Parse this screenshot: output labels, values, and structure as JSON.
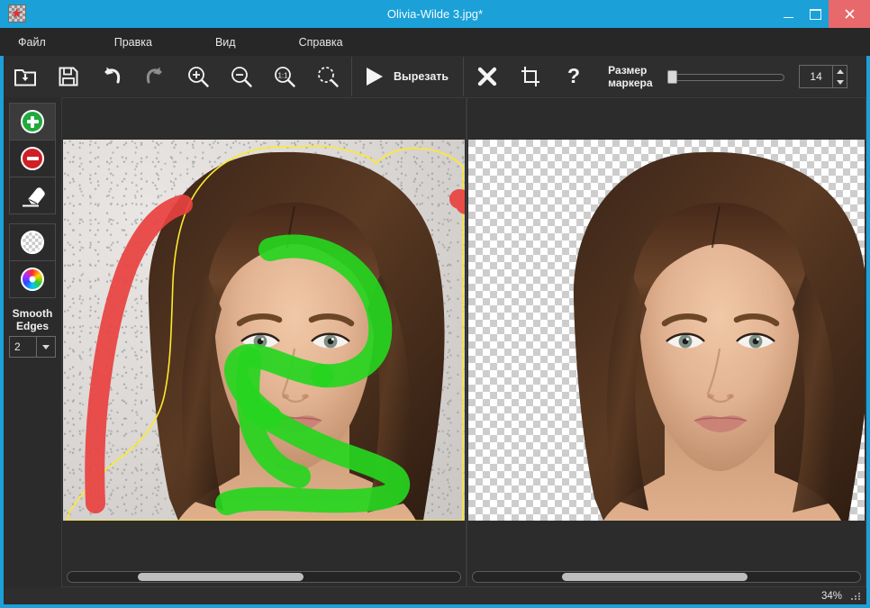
{
  "window": {
    "title": "Olivia-Wilde 3.jpg*",
    "app_icon": "app-logo-icon",
    "minimize": "–",
    "maximize": "□",
    "close": "✕",
    "accent_color": "#1ba1d8",
    "close_color": "#e8696b"
  },
  "menubar": {
    "items": [
      {
        "label": "Файл",
        "name": "menu-file"
      },
      {
        "label": "Правка",
        "name": "menu-edit"
      },
      {
        "label": "Вид",
        "name": "menu-view"
      },
      {
        "label": "Справка",
        "name": "menu-help"
      }
    ]
  },
  "toolbar": {
    "buttons": [
      {
        "name": "open-button",
        "icon": "folder-download-icon",
        "tooltip": "Открыть"
      },
      {
        "name": "save-button",
        "icon": "floppy-save-icon",
        "tooltip": "Сохранить"
      },
      {
        "name": "undo-button",
        "icon": "undo-arrow-icon",
        "tooltip": "Отменить"
      },
      {
        "name": "redo-button",
        "icon": "redo-arrow-icon",
        "tooltip": "Повторить",
        "disabled": true
      },
      {
        "name": "zoom-in-button",
        "icon": "magnifier-plus-icon",
        "tooltip": "Увеличить"
      },
      {
        "name": "zoom-out-button",
        "icon": "magnifier-minus-icon",
        "tooltip": "Уменьшить"
      },
      {
        "name": "zoom-actual-button",
        "icon": "magnifier-1-1-icon",
        "tooltip": "1:1"
      },
      {
        "name": "zoom-fit-button",
        "icon": "magnifier-fit-icon",
        "tooltip": "По размеру окна"
      }
    ],
    "cut_button": {
      "label": "Вырезать",
      "icon": "play-triangle-icon",
      "name": "cut-button"
    },
    "clear_button": {
      "name": "clear-marks-button",
      "icon": "cross-x-icon"
    },
    "crop_button": {
      "name": "crop-button",
      "icon": "crop-icon"
    },
    "help_button": {
      "name": "help-button",
      "icon": "question-mark-icon"
    },
    "marker_size": {
      "label_line1": "Размер",
      "label_line2": "маркера",
      "value": "14",
      "slider_percent": 3,
      "spin_up": "▲",
      "spin_down": "▼"
    }
  },
  "tools": {
    "foreground": {
      "name": "marker-foreground-tool",
      "icon": "green-plus-circle-icon",
      "active": true
    },
    "background": {
      "name": "marker-background-tool",
      "icon": "red-minus-circle-icon",
      "active": false
    },
    "eraser": {
      "name": "eraser-tool",
      "icon": "eraser-icon",
      "active": false
    },
    "transparent_bg": {
      "name": "transparent-background-tool",
      "icon": "checkerboard-circle-icon",
      "active": false
    },
    "color_bg": {
      "name": "color-background-tool",
      "icon": "color-wheel-icon",
      "active": false
    },
    "smooth_edges": {
      "label_line1": "Smooth",
      "label_line2": "Edges",
      "value": "2",
      "dropdown_arrow": "▼",
      "name": "smooth-edges-select"
    }
  },
  "canvas": {
    "left_panel": {
      "name": "source-image-panel",
      "scroll_thumb_percent": 42,
      "scroll_thumb_offset_percent": 18,
      "strokes": {
        "foreground_color": "#26d520",
        "background_color": "#e8413f",
        "outline_color": "#ffe92b"
      }
    },
    "right_panel": {
      "name": "result-image-panel",
      "scroll_thumb_percent": 48,
      "scroll_thumb_offset_percent": 23,
      "background": "transparent-checkerboard"
    }
  },
  "statusbar": {
    "zoom": "34%",
    "resize_grip": "resize-grip-icon"
  }
}
